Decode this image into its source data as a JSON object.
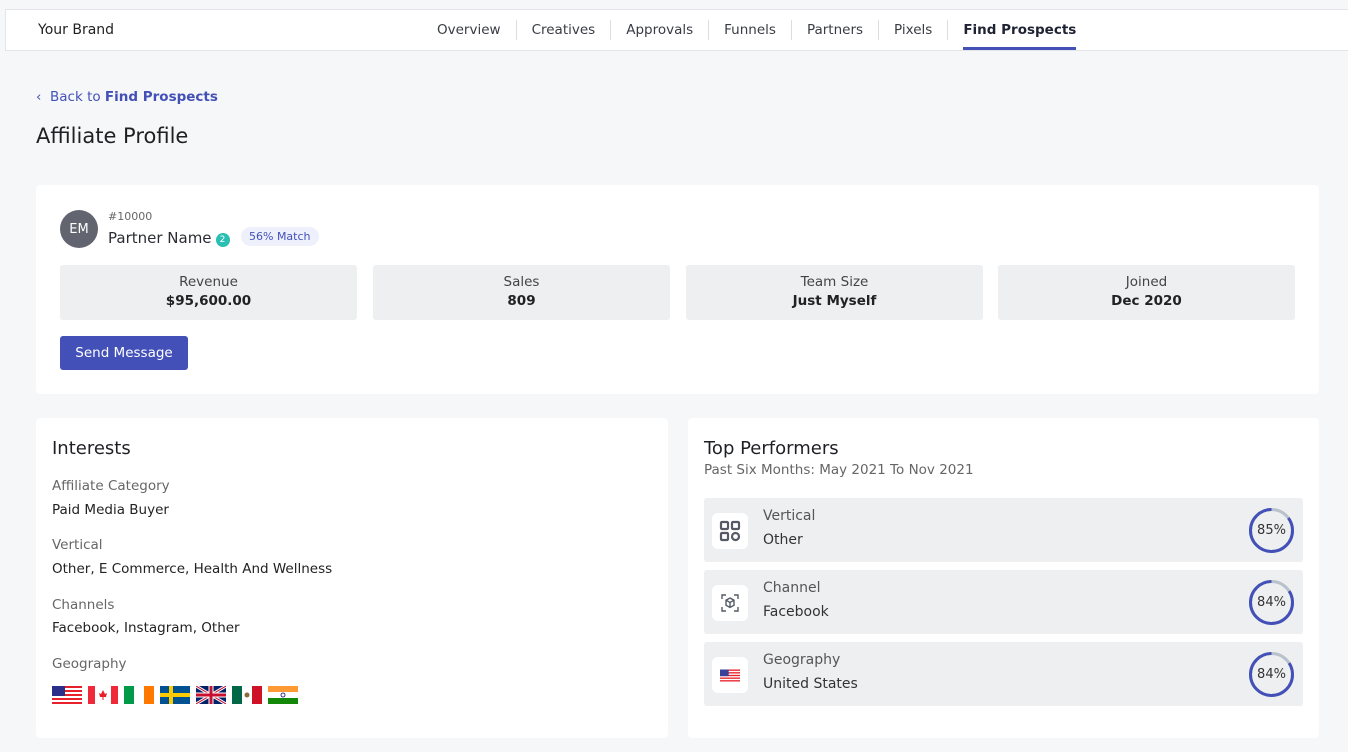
{
  "header": {
    "brand": "Your Brand",
    "nav": [
      "Overview",
      "Creatives",
      "Approvals",
      "Funnels",
      "Partners",
      "Pixels",
      "Find Prospects"
    ],
    "active": "Find Prospects"
  },
  "back": {
    "prefix": "Back to",
    "link": "Find Prospects"
  },
  "page_title": "Affiliate Profile",
  "profile": {
    "initials": "EM",
    "id": "#10000",
    "name": "Partner Name",
    "badge_count": "2",
    "match": "56% Match",
    "stats": [
      {
        "label": "Revenue",
        "value": "$95,600.00"
      },
      {
        "label": "Sales",
        "value": "809"
      },
      {
        "label": "Team Size",
        "value": "Just Myself"
      },
      {
        "label": "Joined",
        "value": "Dec 2020"
      }
    ],
    "send_message": "Send Message"
  },
  "interests": {
    "title": "Interests",
    "fields": [
      {
        "label": "Affiliate Category",
        "value": "Paid Media Buyer"
      },
      {
        "label": "Vertical",
        "value": "Other, E Commerce, Health And Wellness"
      },
      {
        "label": "Channels",
        "value": "Facebook, Instagram, Other"
      },
      {
        "label": "Geography",
        "value": ""
      }
    ],
    "flags": [
      "us-flag",
      "canada-flag",
      "ireland-flag",
      "sweden-flag",
      "uk-flag",
      "mexico-flag",
      "india-flag"
    ]
  },
  "top": {
    "title": "Top Performers",
    "subtitle": "Past Six Months: May 2021 To Nov 2021",
    "rows": [
      {
        "label": "Vertical",
        "value": "Other",
        "pct": "85%",
        "percent": 85,
        "icon": "grid-icon"
      },
      {
        "label": "Channel",
        "value": "Facebook",
        "pct": "84%",
        "percent": 84,
        "icon": "cube-scan-icon"
      },
      {
        "label": "Geography",
        "value": "United States",
        "pct": "84%",
        "percent": 84,
        "icon": "us-flag-icon"
      }
    ]
  },
  "colors": {
    "accent": "#4350b8",
    "badge": "#2bbfb3"
  }
}
